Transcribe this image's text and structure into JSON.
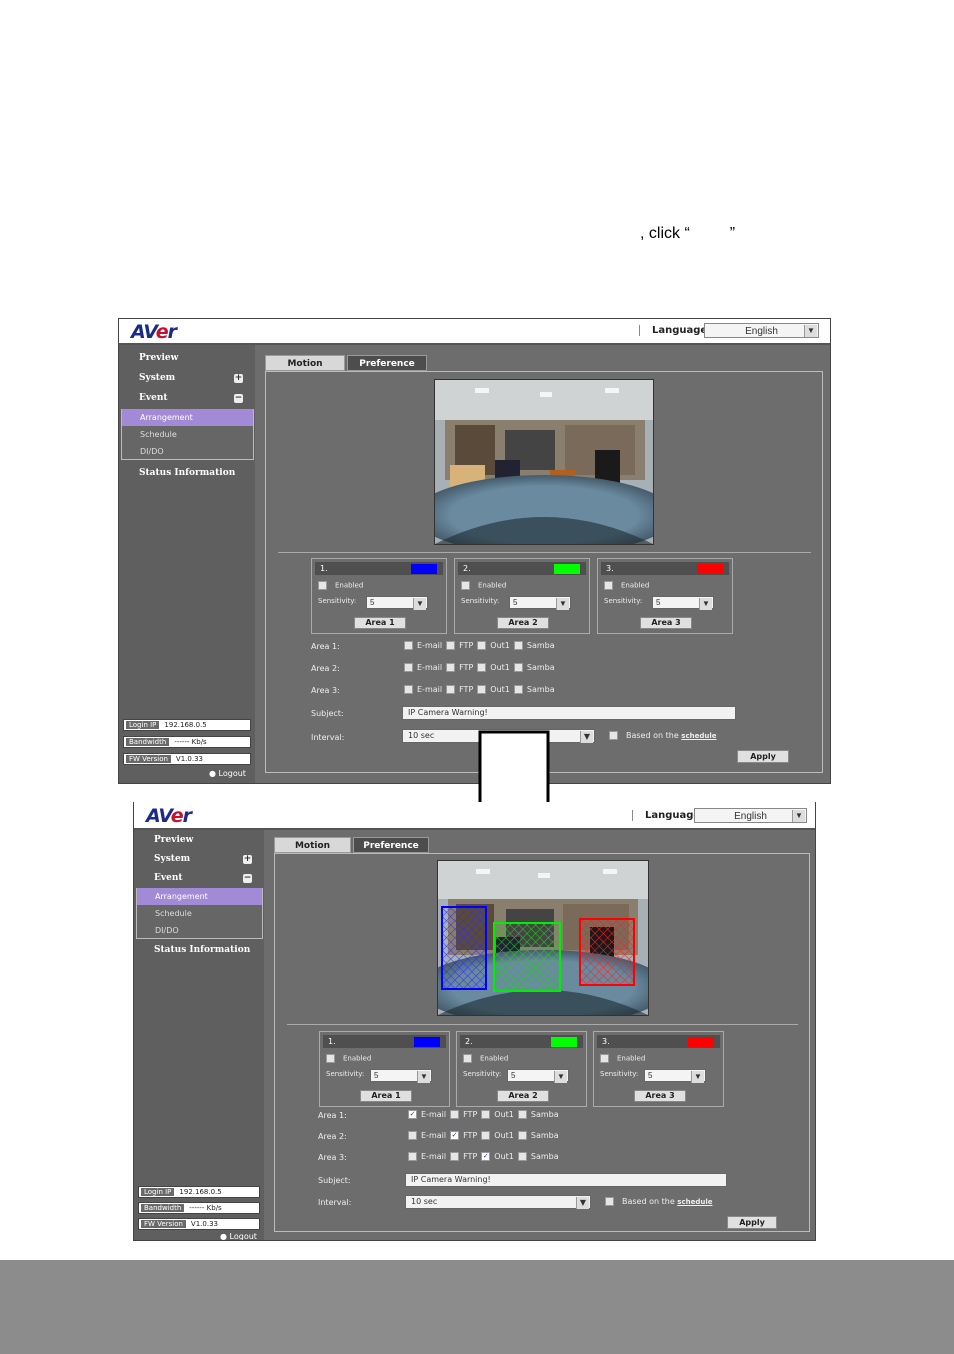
{
  "doc": {
    "instruction_text": ", click “         ”"
  },
  "top": {
    "logo": "AVer",
    "language_label": "Language",
    "language_value": "English",
    "nav": {
      "preview": "Preview",
      "system": "System",
      "event": "Event",
      "status": "Status Information"
    },
    "subnav": [
      "Arrangement",
      "Schedule",
      "DI/DO"
    ],
    "info": [
      {
        "k": "Login IP",
        "v": "192.168.0.5"
      },
      {
        "k": "Bandwidth",
        "v": "------ Kb/s"
      },
      {
        "k": "FW Version",
        "v": "V1.0.33"
      }
    ],
    "logout": "Logout",
    "tabs": [
      "Motion",
      "Preference"
    ],
    "areas": [
      {
        "num": "1.",
        "color": "#0000ff",
        "enabled": "Enabled",
        "sensitivity_label": "Sensitivity:",
        "sensitivity": "5",
        "button": "Area 1"
      },
      {
        "num": "2.",
        "color": "#00ff00",
        "enabled": "Enabled",
        "sensitivity_label": "Sensitivity:",
        "sensitivity": "5",
        "button": "Area 2"
      },
      {
        "num": "3.",
        "color": "#ff0000",
        "enabled": "Enabled",
        "sensitivity_label": "Sensitivity:",
        "sensitivity": "5",
        "button": "Area 3"
      }
    ],
    "rows": [
      {
        "label": "Area 1:",
        "email": false,
        "ftp": false,
        "out1": false,
        "samba": false
      },
      {
        "label": "Area 2:",
        "email": false,
        "ftp": false,
        "out1": false,
        "samba": false
      },
      {
        "label": "Area 3:",
        "email": false,
        "ftp": false,
        "out1": false,
        "samba": false
      }
    ],
    "opt_labels": {
      "email": "E-mail",
      "ftp": "FTP",
      "out1": "Out1",
      "samba": "Samba"
    },
    "subject_label": "Subject:",
    "subject_value": "IP Camera Warning!",
    "interval_label": "Interval:",
    "interval_value": "10 sec",
    "based_on": "Based on the",
    "schedule_link": "schedule",
    "apply": "Apply"
  },
  "bottom": {
    "logo": "AVer",
    "language_label": "Language",
    "language_value": "English",
    "nav": {
      "preview": "Preview",
      "system": "System",
      "event": "Event",
      "status": "Status Information"
    },
    "subnav": [
      "Arrangement",
      "Schedule",
      "DI/DO"
    ],
    "info": [
      {
        "k": "Login IP",
        "v": "192.168.0.5"
      },
      {
        "k": "Bandwidth",
        "v": "------ Kb/s"
      },
      {
        "k": "FW Version",
        "v": "V1.0.33"
      }
    ],
    "logout": "Logout",
    "tabs": [
      "Motion",
      "Preference"
    ],
    "areas": [
      {
        "num": "1.",
        "color": "#0000ff",
        "enabled": "Enabled",
        "sensitivity_label": "Sensitivity:",
        "sensitivity": "5",
        "button": "Area 1"
      },
      {
        "num": "2.",
        "color": "#00ff00",
        "enabled": "Enabled",
        "sensitivity_label": "Sensitivity:",
        "sensitivity": "5",
        "button": "Area 2"
      },
      {
        "num": "3.",
        "color": "#ff0000",
        "enabled": "Enabled",
        "sensitivity_label": "Sensitivity:",
        "sensitivity": "5",
        "button": "Area 3"
      }
    ],
    "rows": [
      {
        "label": "Area 1:",
        "email": true,
        "ftp": false,
        "out1": false,
        "samba": false
      },
      {
        "label": "Area 2:",
        "email": false,
        "ftp": true,
        "out1": false,
        "samba": false
      },
      {
        "label": "Area 3:",
        "email": false,
        "ftp": false,
        "out1": true,
        "samba": false
      }
    ],
    "opt_labels": {
      "email": "E-mail",
      "ftp": "FTP",
      "out1": "Out1",
      "samba": "Samba"
    },
    "subject_label": "Subject:",
    "subject_value": "IP Camera Warning!",
    "interval_label": "Interval:",
    "interval_value": "10 sec",
    "based_on": "Based on the",
    "schedule_link": "schedule",
    "apply": "Apply"
  }
}
